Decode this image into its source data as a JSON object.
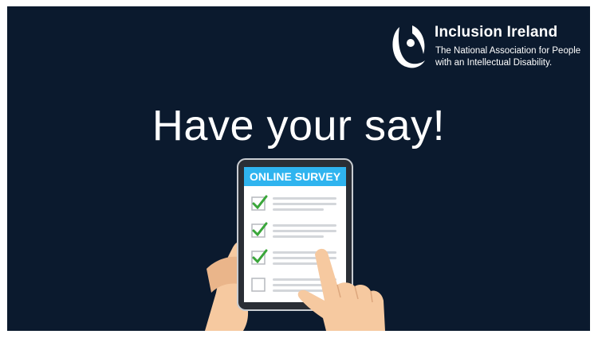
{
  "brand": {
    "name": "Inclusion Ireland",
    "tagline_line1": "The National Association for People",
    "tagline_line2": "with an Intellectual Disability."
  },
  "headline": "Have your say!",
  "tablet": {
    "header": "ONLINE SURVEY",
    "checklist": [
      {
        "checked": true
      },
      {
        "checked": true
      },
      {
        "checked": true
      },
      {
        "checked": false
      }
    ]
  },
  "colors": {
    "background": "#0b1a2e",
    "survey_header": "#2fb4ef",
    "check": "#3aa63a",
    "skin": "#f6c9a0"
  }
}
